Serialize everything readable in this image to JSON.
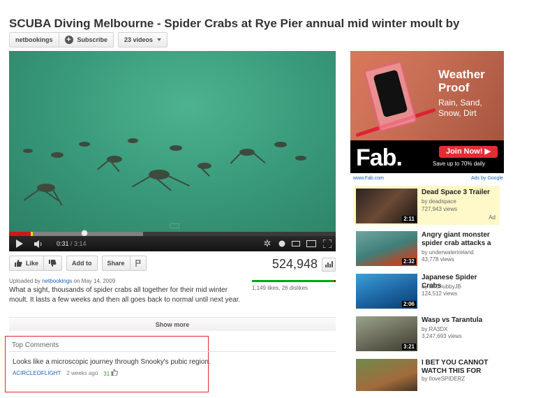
{
  "video": {
    "title": "SCUBA Diving Melbourne - Spider Crabs at Rye Pier annual mid winter moult by",
    "channel": "netbookings",
    "subscribe_label": "Subscribe",
    "videos_label": "23 videos",
    "time_current": "0:31",
    "time_total": "/ 3:14",
    "progress_played_fraction": 0.07,
    "progress_loaded_fraction": 0.41
  },
  "actions": {
    "like_label": "Like",
    "add_to_label": "Add to",
    "share_label": "Share",
    "view_count": "524,948"
  },
  "info": {
    "uploaded_prefix": "Uploaded by",
    "uploader": "netbookings",
    "uploaded_suffix": "on May 14, 2009",
    "description": "What a sight, thousands of spider crabs all together for their mid winter moult. It lasts a few weeks and then all goes back to normal until next year.",
    "likes_dislikes": "1,149 likes, 26 dislikes",
    "like_ratio": 0.98,
    "show_more": "Show more"
  },
  "comments": {
    "heading": "Top Comments",
    "items": [
      {
        "text": "Looks like a microscopic journey through Snooky's pubic region.",
        "author": "ACIRCLEOFLIGHT",
        "age": "2 weeks ago",
        "votes": "31"
      }
    ]
  },
  "ad": {
    "headline": "Weather Proof",
    "subline": "Rain, Sand, Snow, Dirt",
    "brand": "Fab.",
    "join_label": "Join Now! ▶",
    "save_text": "Save up to 70% daily",
    "url": "www.Fab.com",
    "ads_by": "Ads by Google"
  },
  "related": [
    {
      "title": "Dead Space 3 Trailer",
      "channel": "by deadspace",
      "views": "727,943 views",
      "duration": "2:11",
      "ad_label": "Ad",
      "highlight": true
    },
    {
      "title": "Angry giant monster spider crab attacks a",
      "channel": "by underwaterireland",
      "views": "43,778 views",
      "duration": "2:32"
    },
    {
      "title": "Japanese Spider Crabs",
      "channel": "by MrChubbyJB",
      "views": "124,512 views",
      "duration": "2:06"
    },
    {
      "title": "Wasp vs Tarantula",
      "channel": "by RA3DX",
      "views": "3,247,693 views",
      "duration": "3:21"
    },
    {
      "title": "I BET YOU CANNOT WATCH THIS FOR",
      "channel": "by IloveSPIDERZ",
      "views": "",
      "duration": ""
    }
  ]
}
